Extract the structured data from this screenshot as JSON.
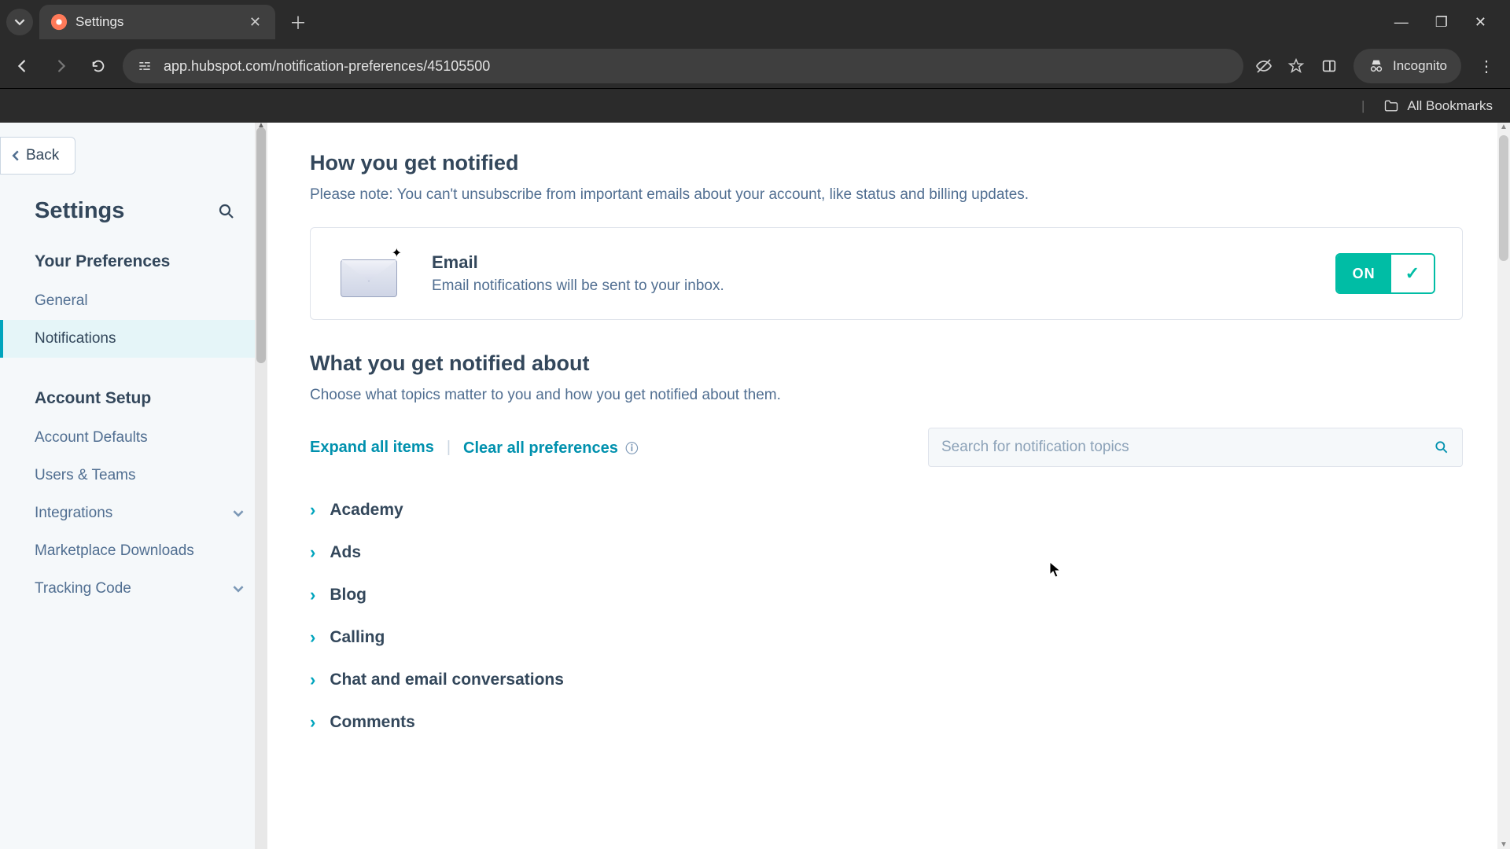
{
  "browser": {
    "tab_title": "Settings",
    "url": "app.hubspot.com/notification-preferences/45105500",
    "incognito_label": "Incognito",
    "all_bookmarks": "All Bookmarks"
  },
  "sidebar": {
    "back_label": "Back",
    "title": "Settings",
    "sections": [
      {
        "title": "Your Preferences",
        "items": [
          {
            "label": "General",
            "active": false
          },
          {
            "label": "Notifications",
            "active": true
          }
        ]
      },
      {
        "title": "Account Setup",
        "items": [
          {
            "label": "Account Defaults"
          },
          {
            "label": "Users & Teams"
          },
          {
            "label": "Integrations",
            "expandable": true
          },
          {
            "label": "Marketplace Downloads"
          },
          {
            "label": "Tracking Code",
            "expandable": true
          }
        ]
      }
    ]
  },
  "main": {
    "section1_title": "How you get notified",
    "section1_note": "Please note: You can't unsubscribe from important emails about your account, like status and billing updates.",
    "email_channel": {
      "title": "Email",
      "desc": "Email notifications will be sent to your inbox.",
      "toggle_state": "ON"
    },
    "section2_title": "What you get notified about",
    "section2_note": "Choose what topics matter to you and how you get notified about them.",
    "expand_all": "Expand all items",
    "clear_all": "Clear all preferences",
    "search_placeholder": "Search for notification topics",
    "topics": [
      "Academy",
      "Ads",
      "Blog",
      "Calling",
      "Chat and email conversations",
      "Comments"
    ]
  }
}
